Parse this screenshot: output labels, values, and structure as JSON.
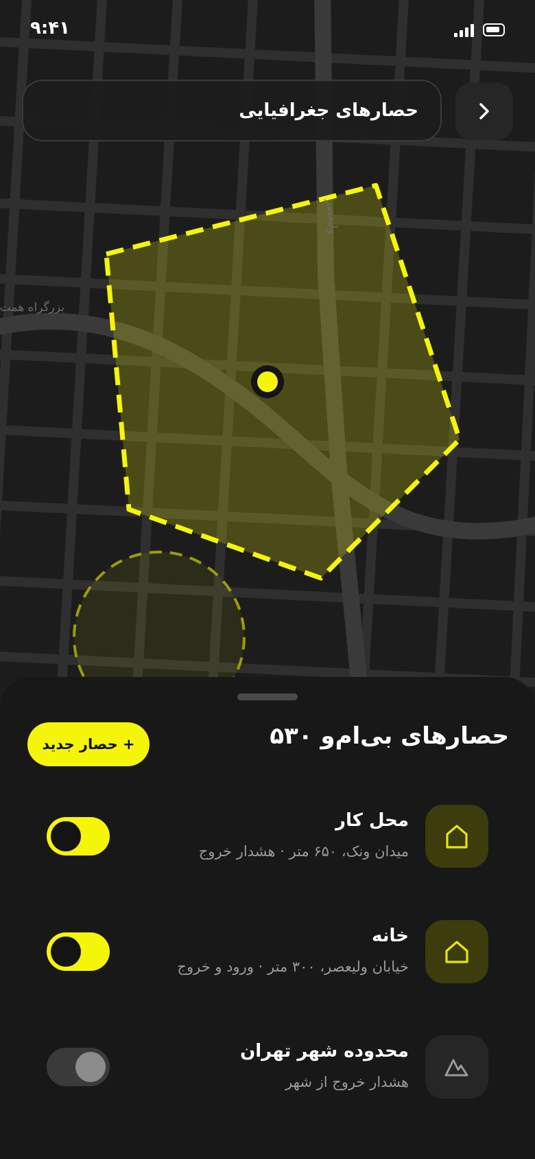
{
  "status_bar": {
    "time": "۹:۴۱"
  },
  "header": {
    "title": "حصارهای جغرافیایی"
  },
  "map": {
    "street_labels": [
      "بزرگراه همت",
      "ولیعصر"
    ]
  },
  "sheet": {
    "title": "حصارهای بی‌ام‌و ۵۳۰",
    "new_button_label": "+ حصار جدید",
    "fences": [
      {
        "name": "محل کار",
        "subtitle": "میدان ونک، ۶۵۰ متر · هشدار خروج",
        "icon": "home-icon",
        "enabled": true
      },
      {
        "name": "خانه",
        "subtitle": "خیابان ولیعصر، ۳۰۰ متر · ورود و خروج",
        "icon": "home-icon",
        "enabled": true
      },
      {
        "name": "محدوده شهر تهران",
        "subtitle": "هشدار خروج از شهر",
        "icon": "mountain-icon",
        "enabled": false
      }
    ]
  },
  "colors": {
    "accent": "#f5f50a",
    "background": "#181818",
    "map_background": "#1c1c1c",
    "map_road": "#2f2f2f"
  }
}
